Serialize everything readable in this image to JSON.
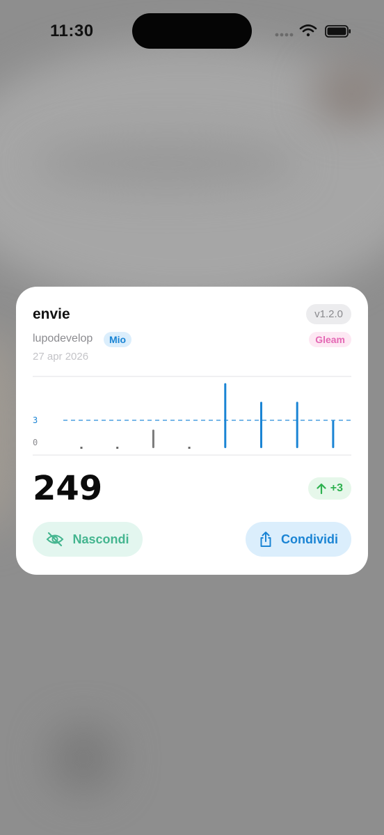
{
  "status_bar": {
    "time": "11:30",
    "icons": [
      "signal-dots-icon",
      "wifi-icon",
      "battery-icon"
    ]
  },
  "card": {
    "name": "envie",
    "version": "v1.2.0",
    "owner": "lupodevelop",
    "owner_badge": "Mio",
    "language": "Gleam",
    "date": "27 apr 2026",
    "count": "249",
    "delta": "+3",
    "actions": {
      "hide_label": "Nascondi",
      "share_label": "Condividi"
    }
  },
  "colors": {
    "accent": "#1a84d4",
    "gray_bar": "#7a7a7a",
    "positive": "#2fb150",
    "hide_accent": "#44b58f",
    "language": "#e468b4"
  },
  "chart_data": {
    "type": "bar",
    "y_ticks": [
      "3",
      "0"
    ],
    "reference_line": 3,
    "ylim": [
      0,
      7.2
    ],
    "values": [
      0,
      0,
      2,
      0,
      7,
      5,
      5,
      3
    ],
    "highlighted": [
      false,
      false,
      false,
      false,
      true,
      true,
      true,
      true
    ],
    "grid": false
  }
}
